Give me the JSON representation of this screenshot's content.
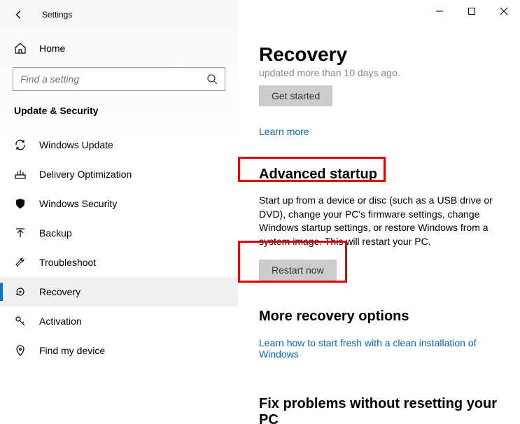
{
  "window": {
    "title": "Settings"
  },
  "sidebar": {
    "home": "Home",
    "search_placeholder": "Find a setting",
    "section": "Update & Security",
    "items": [
      {
        "label": "Windows Update"
      },
      {
        "label": "Delivery Optimization"
      },
      {
        "label": "Windows Security"
      },
      {
        "label": "Backup"
      },
      {
        "label": "Troubleshoot"
      },
      {
        "label": "Recovery"
      },
      {
        "label": "Activation"
      },
      {
        "label": "Find my device"
      }
    ]
  },
  "content": {
    "title": "Recovery",
    "stale_text": "updated more than 10 days ago.",
    "get_started": "Get started",
    "learn_more": "Learn more",
    "advanced": {
      "heading": "Advanced startup",
      "desc": "Start up from a device or disc (such as a USB drive or DVD), change your PC's firmware settings, change Windows startup settings, or restore Windows from a system image. This will restart your PC.",
      "button": "Restart now"
    },
    "more": {
      "heading": "More recovery options",
      "link": "Learn how to start fresh with a clean installation of Windows"
    },
    "fix_heading": "Fix problems without resetting your PC"
  }
}
